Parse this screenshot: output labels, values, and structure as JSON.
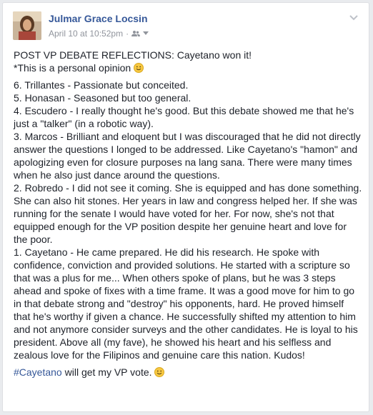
{
  "post": {
    "author": "Julmar Grace Locsin",
    "timestamp": "April 10 at 10:52pm",
    "separator": "·",
    "title": "POST VP DEBATE REFLECTIONS: Cayetano won it!",
    "note": "*This is a personal opinion",
    "items": [
      "6. Trillantes - Passionate but conceited.",
      "5. Honasan - Seasoned but too general.",
      "4. Escudero - I really thought he's good. But this debate showed me that he's just a \"talker\" (in a robotic way).",
      "3. Marcos - Brilliant and eloquent but I was discouraged that he did not directly answer the questions I longed to be addressed. Like Cayetano's \"hamon\" and apologizing even for closure purposes na lang sana. There were many times when he also just dance around the questions.",
      "2. Robredo - I did not see it coming. She is equipped and has done something. She can also hit stones. Her years in law and congress helped her. If she was running for the senate I would have voted for her. For now, she's not that equipped enough for the VP position despite her genuine heart and love for the poor.",
      "1. Cayetano - He came prepared. He did his research. He spoke with confidence, conviction and provided solutions. He started with a scripture so that was a plus for me... When others spoke of plans, but he was 3 steps ahead and spoke of fixes with a time frame. It was a good move for him to go in that debate strong and \"destroy\" his opponents, hard. He proved himself that he's worthy if given a chance. He successfully shifted my attention to him and not anymore consider surveys and the other candidates. He is loyal to his president. Above all (my fave), he showed his heart and his selfless and zealous love for the Filipinos and genuine care this nation. Kudos!"
    ],
    "hashtag": "#Cayetano",
    "closing": " will get my VP vote."
  },
  "colors": {
    "link": "#365899",
    "text": "#1d2129",
    "meta": "#90949c"
  }
}
